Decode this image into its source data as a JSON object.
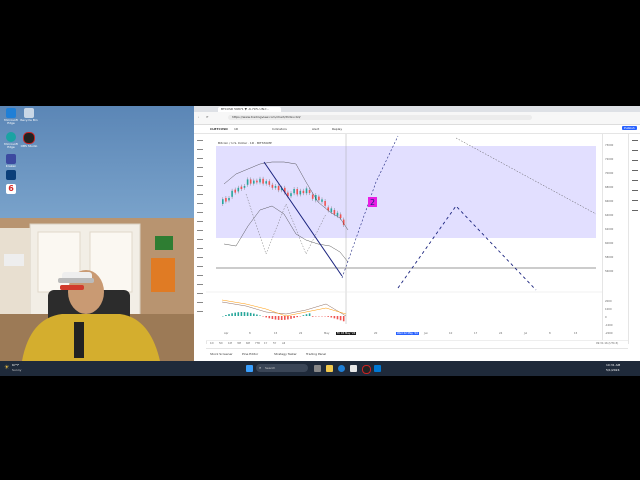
{
  "desktop": {
    "icons": [
      {
        "label": "Microsoft Edge",
        "color": "#1f7fd6"
      },
      {
        "label": "Recycle Bin",
        "color": "#c9d7e6"
      },
      {
        "label": "Microsoft Edge",
        "color": "#1aa3a3"
      },
      {
        "label": "OBS Studio",
        "color": "#222222"
      },
      {
        "label": "Kraken",
        "color": "#3c4aa0"
      },
      {
        "label": "",
        "color": "#6b2fb3"
      },
      {
        "label": "",
        "color": "#0b3f7a"
      },
      {
        "label": "",
        "color": "#d42a2a"
      }
    ]
  },
  "browser": {
    "tab_title": "BTCUSD 56871 ▼ -6.79% UN-Y...",
    "url": "https://www.tradingview.com/chart/Xtdxvc4d/",
    "symbol": "CLBTCUSD",
    "timeframe": "1D",
    "toolbar": [
      "Indicators",
      "Alert",
      "Replay"
    ],
    "pair_title": "Bitcoin / U.S. Dollar · 1D · BITSTAMP",
    "publish_label": "Publish",
    "wave_label": "2",
    "x_ticks": [
      "Apr",
      "8",
      "15",
      "22",
      "May",
      "13",
      "20",
      "27",
      "Jun",
      "10",
      "17",
      "24",
      "Jul",
      "8",
      "15"
    ],
    "price_ticks": [
      "73000",
      "72000",
      "70000",
      "68000",
      "66000",
      "64000",
      "62000",
      "60000",
      "58000",
      "56000"
    ],
    "macd_ticks": [
      "2000",
      "1000",
      "0",
      "-1000",
      "-2000"
    ],
    "cursor_date": "Fri 03 May '24",
    "highlight_date": "Wed 22 May '24",
    "ranges": [
      "1D",
      "5D",
      "1M",
      "3M",
      "6M",
      "YTD",
      "1Y",
      "5Y",
      "All"
    ],
    "clock": "09:31:16 (UTC-5)",
    "bottom_tabs": [
      "Stock Screener",
      "Pine Editor",
      "Strategy Tester",
      "Trading Panel"
    ]
  },
  "taskbar": {
    "weather_temp": "67°F",
    "weather_desc": "Sunny",
    "search_placeholder": "Search",
    "time": "10:31 AM",
    "date": "5/1/2024"
  },
  "colors": {
    "accent": "#2962ff",
    "up": "#26a69a",
    "down": "#ef5350",
    "zone": "#d8d4ff",
    "wave_label_bg": "#e91ee4"
  }
}
